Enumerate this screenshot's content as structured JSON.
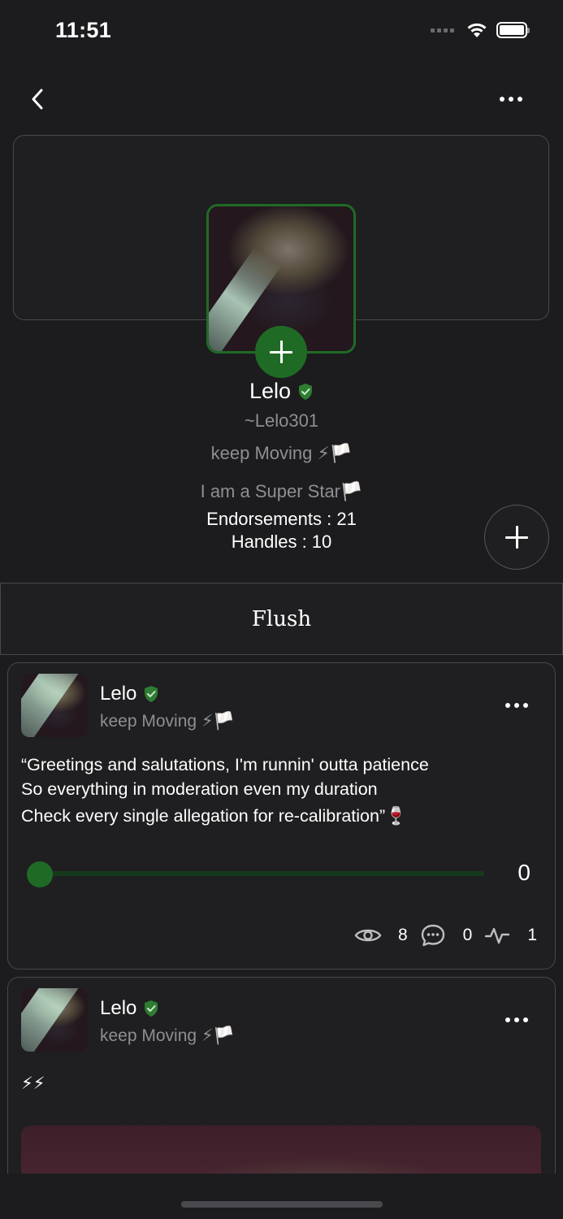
{
  "status_bar": {
    "time": "11:51"
  },
  "colors": {
    "accent": "#1f6b25",
    "background": "#1c1c1e",
    "muted_text": "#8e8e93",
    "border": "#48484c"
  },
  "icons": {
    "back": "chevron-left-icon",
    "more": "ellipsis-icon",
    "add_photo": "plus-icon",
    "verified": "shield-check-icon",
    "views": "eye-icon",
    "comments": "chat-bubble-icon",
    "activity": "pulse-icon"
  },
  "profile": {
    "name": "Lelo",
    "handle": "~Lelo301",
    "tagline": "keep Moving ⚡🏳️",
    "bio": "I am a Super Star🏳️",
    "endorsements": "Endorsements : 21",
    "handles": "Handles : 10"
  },
  "tabs": {
    "active": "Flush"
  },
  "posts": [
    {
      "author": "Lelo",
      "tagline": "keep Moving ⚡🏳️",
      "lines": [
        "“Greetings and salutations, I'm runnin' outta patience",
        "So everything in moderation even my duration",
        "Check every single allegation for re-calibration”🍷"
      ],
      "slider_value": "0",
      "slider_fraction": 0,
      "views": "8",
      "comments": "0",
      "activity": "1"
    },
    {
      "author": "Lelo",
      "tagline": "keep Moving ⚡🏳️",
      "text": "⚡⚡"
    }
  ]
}
